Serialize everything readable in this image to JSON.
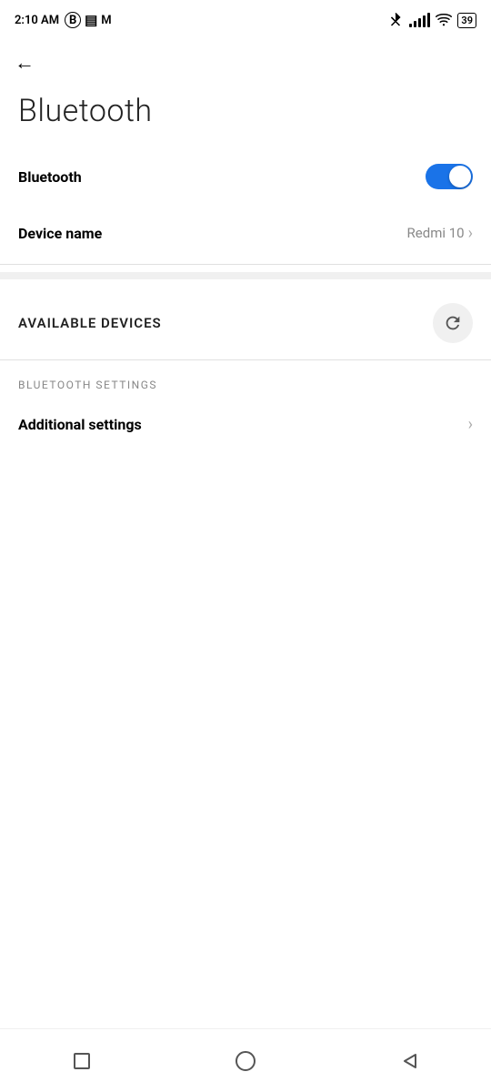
{
  "statusBar": {
    "time": "2:10 AM",
    "batteryLevel": "39"
  },
  "header": {
    "backLabel": "←",
    "title": "Bluetooth"
  },
  "settings": {
    "bluetoothLabel": "Bluetooth",
    "bluetoothEnabled": true,
    "deviceNameLabel": "Device name",
    "deviceNameValue": "Redmi 10",
    "availableDevicesLabel": "AVAILABLE DEVICES",
    "bluetoothSettingsLabel": "BLUETOOTH SETTINGS",
    "additionalSettingsLabel": "Additional settings"
  },
  "bottomNav": {
    "squareLabel": "■",
    "circleLabel": "○",
    "triangleLabel": "◁"
  }
}
